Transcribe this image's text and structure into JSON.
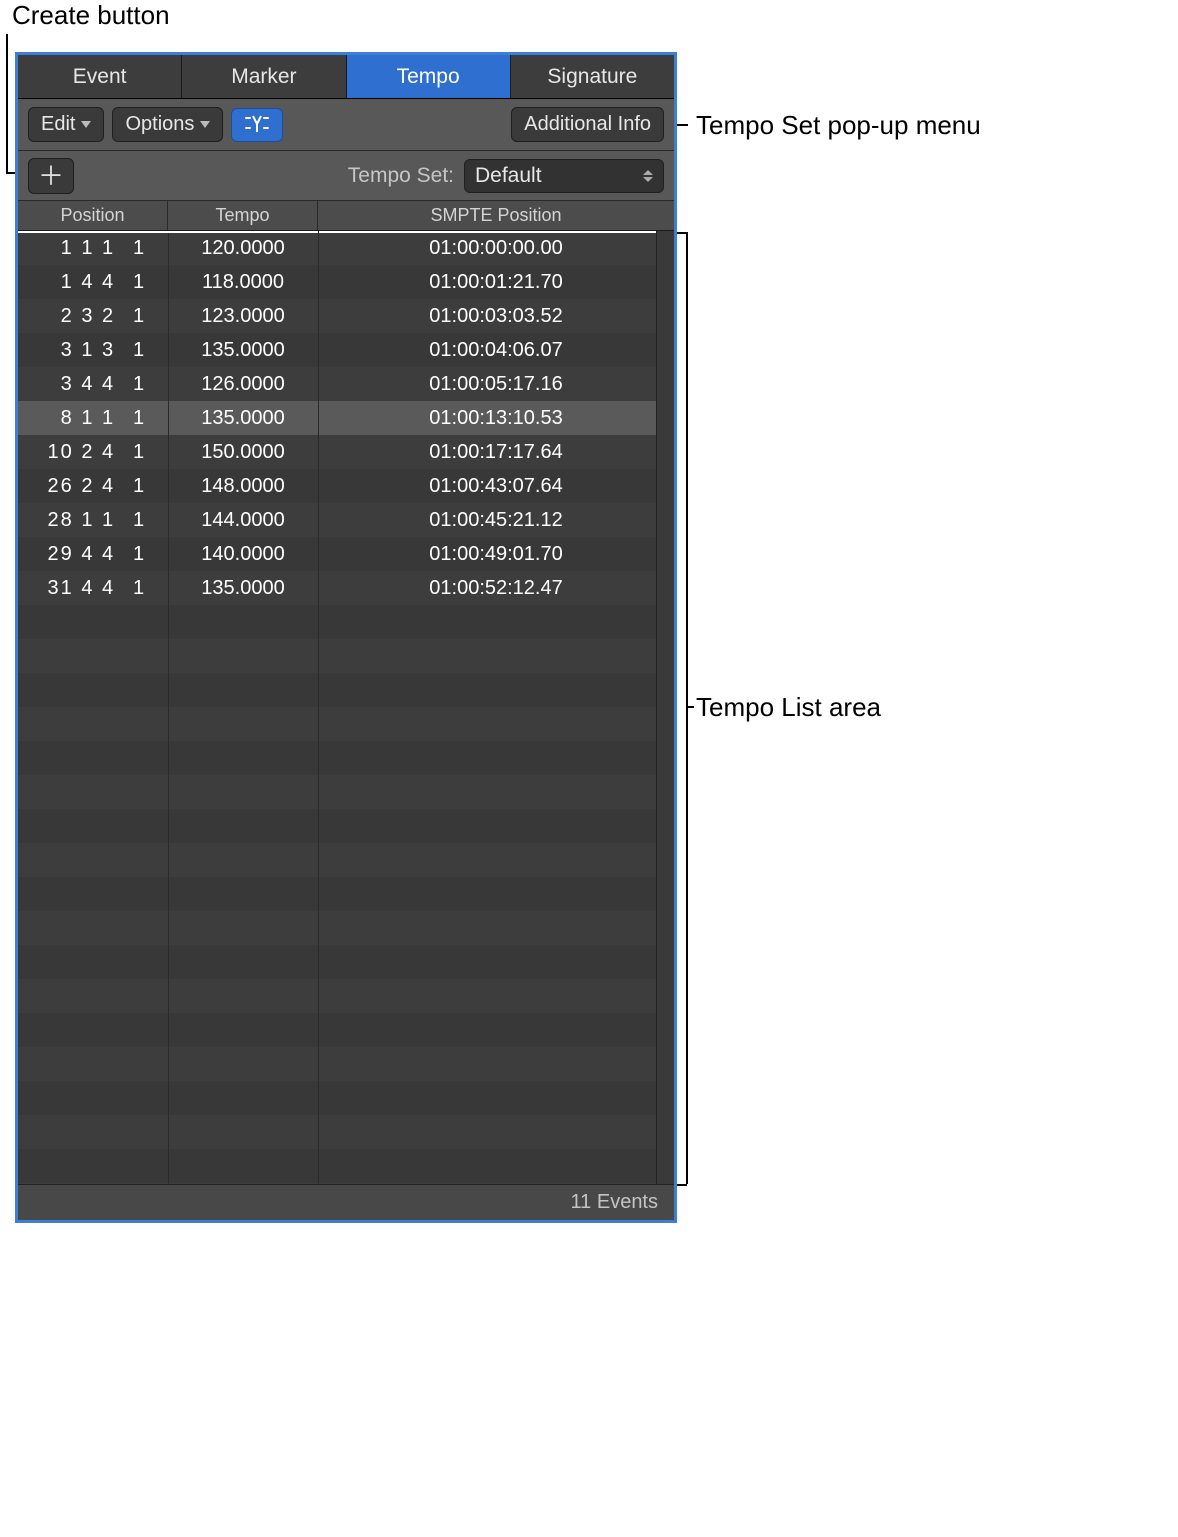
{
  "callouts": {
    "create_button": "Create button",
    "tempo_set_menu": "Tempo Set pop-up menu",
    "tempo_list_area": "Tempo List area"
  },
  "tabs": {
    "event": "Event",
    "marker": "Marker",
    "tempo": "Tempo",
    "signature": "Signature",
    "active": "tempo"
  },
  "toolbar": {
    "edit": "Edit",
    "options": "Options",
    "additional_info": "Additional Info"
  },
  "tempo_set": {
    "label": "Tempo Set:",
    "value": "Default"
  },
  "columns": {
    "position": "Position",
    "tempo": "Tempo",
    "smpte": "SMPTE Position"
  },
  "rows": [
    {
      "pos": "1 1 1",
      "sub": "1",
      "tempo": "120.0000",
      "smpte": "01:00:00:00.00",
      "selected": false
    },
    {
      "pos": "1 4 4",
      "sub": "1",
      "tempo": "118.0000",
      "smpte": "01:00:01:21.70",
      "selected": false
    },
    {
      "pos": "2 3 2",
      "sub": "1",
      "tempo": "123.0000",
      "smpte": "01:00:03:03.52",
      "selected": false
    },
    {
      "pos": "3 1 3",
      "sub": "1",
      "tempo": "135.0000",
      "smpte": "01:00:04:06.07",
      "selected": false
    },
    {
      "pos": "3 4 4",
      "sub": "1",
      "tempo": "126.0000",
      "smpte": "01:00:05:17.16",
      "selected": false
    },
    {
      "pos": "8 1 1",
      "sub": "1",
      "tempo": "135.0000",
      "smpte": "01:00:13:10.53",
      "selected": true
    },
    {
      "pos": "10 2 4",
      "sub": "1",
      "tempo": "150.0000",
      "smpte": "01:00:17:17.64",
      "selected": false
    },
    {
      "pos": "26 2 4",
      "sub": "1",
      "tempo": "148.0000",
      "smpte": "01:00:43:07.64",
      "selected": false
    },
    {
      "pos": "28 1 1",
      "sub": "1",
      "tempo": "144.0000",
      "smpte": "01:00:45:21.12",
      "selected": false
    },
    {
      "pos": "29 4 4",
      "sub": "1",
      "tempo": "140.0000",
      "smpte": "01:00:49:01.70",
      "selected": false
    },
    {
      "pos": "31 4 4",
      "sub": "1",
      "tempo": "135.0000",
      "smpte": "01:00:52:12.47",
      "selected": false
    }
  ],
  "footer": {
    "event_count": "11 Events"
  },
  "colors": {
    "accent": "#2f6fd0",
    "selection": "#5a5a5a"
  }
}
